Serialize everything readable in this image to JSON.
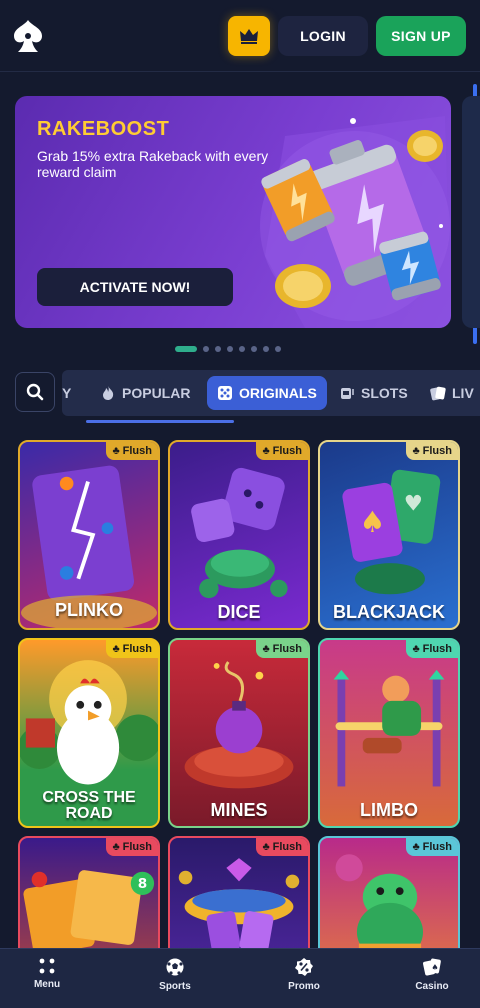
{
  "header": {
    "login_label": "LOGIN",
    "signup_label": "SIGN UP",
    "crown_icon": "crown-icon",
    "colors": {
      "crown": "#f7b500",
      "signup": "#1aa35a",
      "login": "#1e2440"
    }
  },
  "banner": {
    "title": "RAKEBOOST",
    "subtitle": "Grab 15% extra Rakeback with every reward claim",
    "cta_label": "ACTIVATE NOW!",
    "slides_total": 8,
    "active_slide": 1
  },
  "categories": {
    "partial_left": "Y",
    "tabs": [
      {
        "label": "POPULAR",
        "icon": "fire-icon"
      },
      {
        "label": "ORIGINALS",
        "icon": "dice-icon",
        "active": true
      },
      {
        "label": "SLOTS",
        "icon": "slot-machine-icon"
      },
      {
        "label": "LIV",
        "icon": "cards-icon"
      }
    ]
  },
  "games": [
    {
      "title": "PLINKO",
      "tag": "Flush",
      "border": "#e0a92a"
    },
    {
      "title": "DICE",
      "tag": "Flush",
      "border": "#e0a92a"
    },
    {
      "title": "BLACKJACK",
      "tag": "Flush",
      "border": "#e6d58a"
    },
    {
      "title": "CROSS THE ROAD",
      "tag": "Flush",
      "border": "#f0c419"
    },
    {
      "title": "MINES",
      "tag": "Flush",
      "border": "#7ad38a"
    },
    {
      "title": "LIMBO",
      "tag": "Flush",
      "border": "#4fd6b0"
    },
    {
      "title": "",
      "tag": "Flush",
      "border": "#e84a5f"
    },
    {
      "title": "",
      "tag": "Flush",
      "border": "#e84a5f"
    },
    {
      "title": "",
      "tag": "Flush",
      "border": "#5bc6d8"
    }
  ],
  "bottom_nav": [
    {
      "label": "Menu",
      "icon": "menu-grid-icon"
    },
    {
      "label": "Sports",
      "icon": "soccer-ball-icon"
    },
    {
      "label": "Promo",
      "icon": "percent-badge-icon"
    },
    {
      "label": "Casino",
      "icon": "playing-cards-icon"
    }
  ]
}
